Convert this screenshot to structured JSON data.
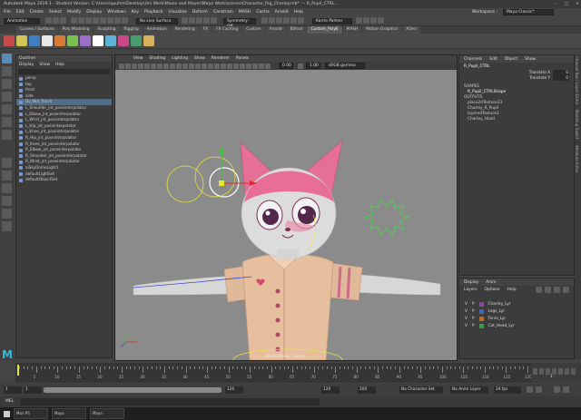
{
  "window": {
    "title": "Autodesk Maya 2019.1 - Student Version: C:\\Users\\apuhm\\Desktop\\Uni Work\\Maxie and Mayer\\Maya Work\\scenes\\Character_Rig_Charley.mb* --- R_Pupil_CTRL...",
    "controls": [
      "–",
      "□",
      "×"
    ]
  },
  "menubar": {
    "items": [
      "File",
      "Edit",
      "Create",
      "Select",
      "Modify",
      "Display",
      "Windows",
      "Key",
      "Playback",
      "Visualize",
      "Deform",
      "Constrain",
      "MASH",
      "Cache",
      "Arnold",
      "Help"
    ],
    "workspace_label": "Workspace :",
    "workspace_value": "Maya Classic*"
  },
  "statusline": {
    "mode": "Animation",
    "no_live_surface": "No Live Surface",
    "symmetry": "Symmetry: Off",
    "user": "Karrie Palmer"
  },
  "shelf": {
    "tabs": [
      "Curves / Surfaces",
      "Poly Modeling",
      "Sculpting",
      "Rigging",
      "Animation",
      "Rendering",
      "FX",
      "FX Caching",
      "Custom",
      "Arnold",
      "Bifrost",
      "Custom_PolyE",
      "MASH",
      "Motion Graphics",
      "XGen"
    ],
    "active_tab": "Custom_PolyE",
    "icon_colors": [
      "#c94a4a",
      "#d3c255",
      "#3f7fc1",
      "#e8e8e8",
      "#d67a35",
      "#7bbd4e",
      "#9b6ec9",
      "#ffffff",
      "#5cb3d6",
      "#c94a8a",
      "#4a9b6e",
      "#d6b25c"
    ]
  },
  "outliner": {
    "title": "Outliner",
    "menu": [
      "Display",
      "Show",
      "Help"
    ],
    "items": [
      {
        "label": "persp",
        "selected": false
      },
      {
        "label": "top",
        "selected": false
      },
      {
        "label": "front",
        "selected": false
      },
      {
        "label": "side",
        "selected": false
      },
      {
        "label": "Do_Not_Touch",
        "selected": true
      },
      {
        "label": "L_Shoulder_jnt_poseinterpolator",
        "selected": false
      },
      {
        "label": "L_Elbow_jnt_poseinterpolator",
        "selected": false
      },
      {
        "label": "L_Wrist_jnt_poseinterpolator",
        "selected": false
      },
      {
        "label": "L_Hip_jnt_poseinterpolator",
        "selected": false
      },
      {
        "label": "L_Knee_jnt_poseinterpolator",
        "selected": false
      },
      {
        "label": "R_Hip_jnt_poseinterpolator",
        "selected": false
      },
      {
        "label": "R_Knee_jnt_poseinterpolator",
        "selected": false
      },
      {
        "label": "R_Elbow_jnt_poseinterpolator",
        "selected": false
      },
      {
        "label": "R_Shoulder_jnt_poseinterpolator",
        "selected": false
      },
      {
        "label": "R_Wrist_jnt_poseinterpolator",
        "selected": false
      },
      {
        "label": "aiSkyDomeLight1",
        "selected": false
      },
      {
        "label": "defaultLightSet",
        "selected": false
      },
      {
        "label": "defaultObjectSet",
        "selected": false
      }
    ]
  },
  "viewport": {
    "menu": [
      "View",
      "Shading",
      "Lighting",
      "Show",
      "Renderer",
      "Panels"
    ],
    "exposure": "0.00",
    "gamma": "1.00",
    "color_space": "sRGB gamma",
    "camera_label": "3D PenDown : persp"
  },
  "channelbox": {
    "tabs": [
      "Channels",
      "Edit",
      "Object",
      "Show"
    ],
    "node": "R_Pupil_CTRL",
    "attrs": [
      {
        "name": "Translate X",
        "value": "0"
      },
      {
        "name": "Translate Y",
        "value": "0"
      }
    ],
    "shapes_header": "SHAPES",
    "shape": "R_Pupil_CTRLShape",
    "outputs_header": "OUTPUTS",
    "outputs": [
      "place2dTexture23",
      "Charley_R_Pupil",
      "layeredTexture3",
      "Charley_Head"
    ]
  },
  "layers": {
    "tabs": [
      "Display",
      "Anim"
    ],
    "menu": [
      "Layers",
      "Options",
      "Help"
    ],
    "items": [
      {
        "v": "V",
        "p": "P",
        "name": "Charley_Lyr",
        "color": "#8a4a9a"
      },
      {
        "v": "V",
        "p": "P",
        "name": "Legs_Lyr",
        "color": "#3e6bb0"
      },
      {
        "v": "V",
        "p": "P",
        "name": "Torso_Lyr",
        "color": "#c06a2a"
      },
      {
        "v": "V",
        "p": "P",
        "name": "Cat_Head_Lyr",
        "color": "#3a9a4a"
      }
    ]
  },
  "right_tabs": [
    "Channel Box / Layer Editor",
    "Modeling Toolkit",
    "Attribute Editor"
  ],
  "timeslider": {
    "labels": [
      "5",
      "10",
      "15",
      "20",
      "25",
      "30",
      "35",
      "40",
      "45",
      "50",
      "55",
      "60",
      "65",
      "70",
      "75",
      "80",
      "85",
      "90",
      "95",
      "100",
      "105",
      "110",
      "115",
      "120"
    ],
    "current": "1"
  },
  "range": {
    "start": "1",
    "start_inner": "1",
    "end_inner": "120",
    "end": "120",
    "max": "200",
    "character_set": "No Character Set",
    "anim_layer": "No Anim Layer",
    "fps": "24 fps"
  },
  "mel_label": "MEL",
  "taskbar": {
    "windows": [
      "Mari PS",
      "Maya",
      "Maya"
    ]
  }
}
